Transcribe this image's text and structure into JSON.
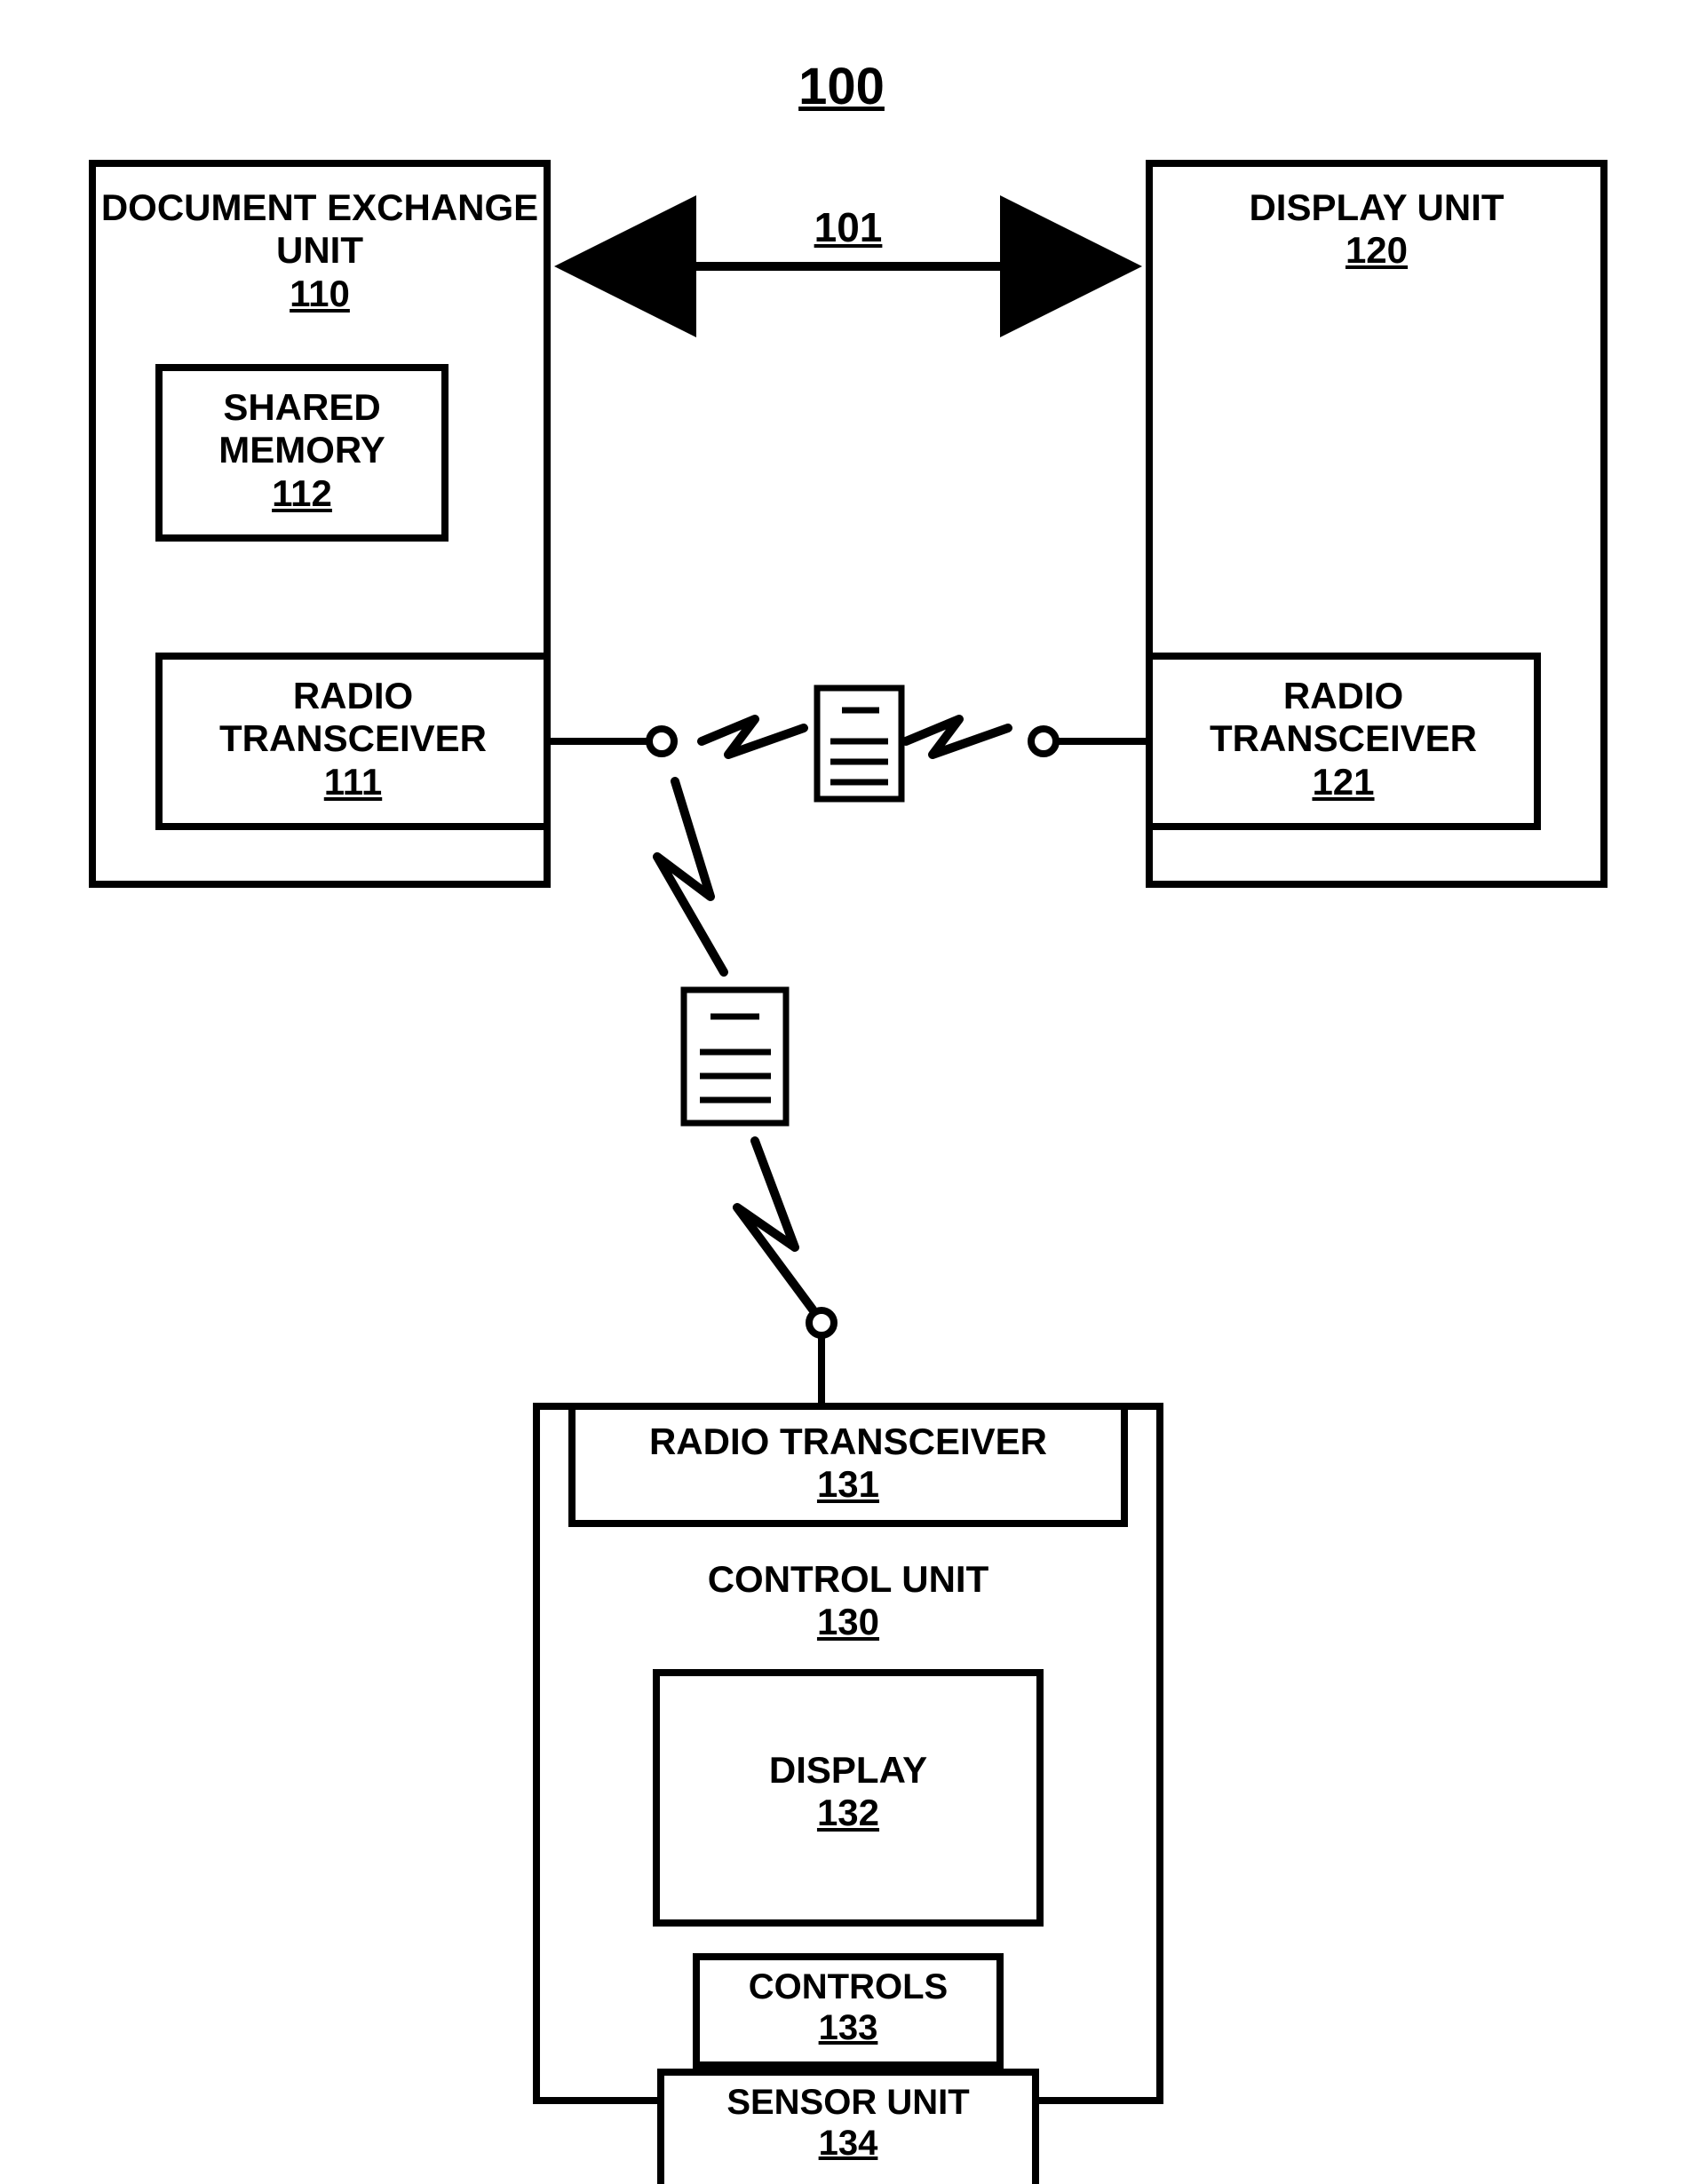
{
  "diagram": {
    "system_ref": "100",
    "link_ref": "101",
    "doc_exchange": {
      "title": "DOCUMENT EXCHANGE UNIT",
      "ref": "110"
    },
    "shared_memory": {
      "title": "SHARED MEMORY",
      "ref": "112"
    },
    "transceiver_a": {
      "title": "RADIO TRANSCEIVER",
      "ref": "111"
    },
    "display_unit": {
      "title": "DISPLAY UNIT",
      "ref": "120"
    },
    "transceiver_b": {
      "title": "RADIO TRANSCEIVER",
      "ref": "121"
    },
    "control_unit": {
      "title": "CONTROL UNIT",
      "ref": "130"
    },
    "transceiver_c": {
      "title": "RADIO TRANSCEIVER",
      "ref": "131"
    },
    "display": {
      "title": "DISPLAY",
      "ref": "132"
    },
    "controls": {
      "title": "CONTROLS",
      "ref": "133"
    },
    "sensor": {
      "title": "SENSOR UNIT",
      "ref": "134"
    }
  }
}
